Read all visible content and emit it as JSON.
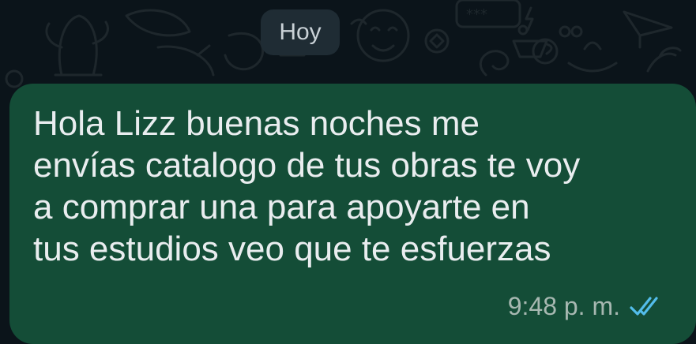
{
  "chat": {
    "date_separator": "Hoy"
  },
  "message": {
    "text": "Hola Lizz buenas noches me\nenvías catalogo de tus obras te voy\na comprar una para apoyarte en\ntus estudios veo que te esfuerzas",
    "time": "9:48 p. m.",
    "status_icon": "double-check-read-icon"
  },
  "colors": {
    "background": "#0b141a",
    "bubble_outgoing": "#144d37",
    "date_chip": "#1f2c34",
    "text_primary": "#e9edef",
    "text_meta": "#a7b8b1",
    "read_ticks": "#53bdeb"
  }
}
